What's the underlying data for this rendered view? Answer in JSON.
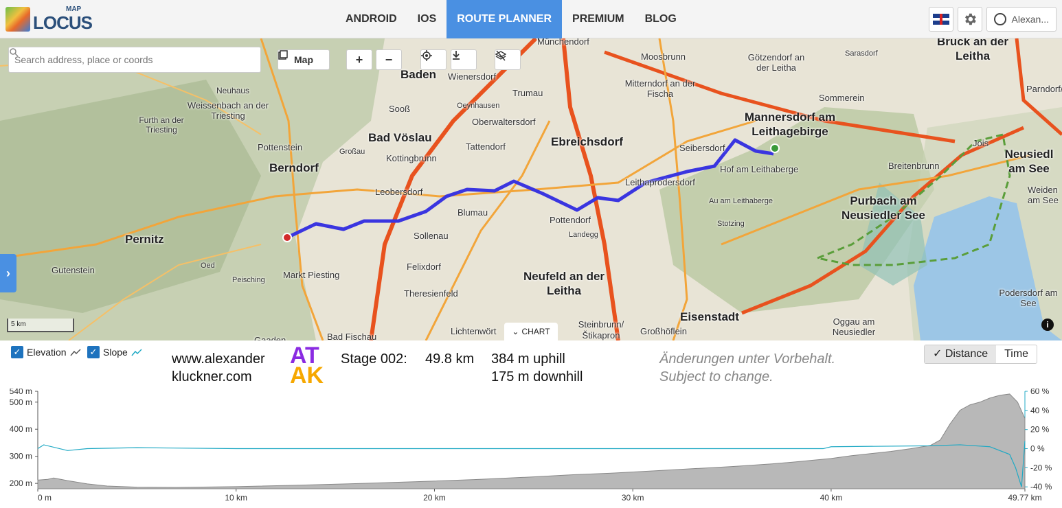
{
  "app": {
    "logo_word": "LOCUS",
    "logo_small": "MAP"
  },
  "nav": [
    {
      "label": "ANDROID",
      "active": false
    },
    {
      "label": "IOS",
      "active": false
    },
    {
      "label": "ROUTE PLANNER",
      "active": true
    },
    {
      "label": "PREMIUM",
      "active": false
    },
    {
      "label": "BLOG",
      "active": false
    }
  ],
  "header_right": {
    "language_icon": "uk-flag-icon",
    "settings_icon": "gear-icon",
    "user_name": "Alexan..."
  },
  "map_controls": {
    "search_placeholder": "Search address, place or coords",
    "search_icon": "search-icon",
    "map_button": "Map",
    "zoom_in": "+",
    "zoom_out": "−",
    "locate_icon": "crosshair-icon",
    "download_icon": "download-icon",
    "layers_off_icon": "layers-off-icon",
    "sidebar_toggle_icon": "chevron-right-icon",
    "scale_label": "5 km",
    "chart_toggle": "CHART",
    "info": "i"
  },
  "map_labels": [
    {
      "text": "Baden",
      "big": true
    },
    {
      "text": "Wienersdorf"
    },
    {
      "text": "Trumau"
    },
    {
      "text": "Münchendorf"
    },
    {
      "text": "Moosbrunn"
    },
    {
      "text": "Götzendorf an der Leitha"
    },
    {
      "text": "Sarasdorf"
    },
    {
      "text": "Bruck an der Leitha",
      "big": true
    },
    {
      "text": "Parndorf/Pa"
    },
    {
      "text": "Neuhaus"
    },
    {
      "text": "Weissenbach an der Triesting"
    },
    {
      "text": "Furth an der Triesting"
    },
    {
      "text": "Sooß"
    },
    {
      "text": "Oeynhausen"
    },
    {
      "text": "Oberwaltersdorf"
    },
    {
      "text": "Mitterndorf an der Fischa"
    },
    {
      "text": "Sommerein"
    },
    {
      "text": "Mannersdorf am Leithagebirge",
      "big": true
    },
    {
      "text": "Bad Vöslau",
      "big": true
    },
    {
      "text": "Tattendorf"
    },
    {
      "text": "Ebreichsdorf",
      "big": true
    },
    {
      "text": "Seibersdorf"
    },
    {
      "text": "Jois"
    },
    {
      "text": "Neusiedl am See",
      "big": true
    },
    {
      "text": "Pottenstein"
    },
    {
      "text": "Großau"
    },
    {
      "text": "Kottingbrunn"
    },
    {
      "text": "Hof am Leithaberge"
    },
    {
      "text": "Breitenbrunn"
    },
    {
      "text": "Weiden am See"
    },
    {
      "text": "Berndorf",
      "big": true
    },
    {
      "text": "Leobersdorf"
    },
    {
      "text": "Leithaprodersdorf"
    },
    {
      "text": "Au am Leithaberge"
    },
    {
      "text": "Purbach am Neusiedler See",
      "big": true
    },
    {
      "text": "Blumau"
    },
    {
      "text": "Pottendorf"
    },
    {
      "text": "Stotzing"
    },
    {
      "text": "Pernitz",
      "big": true
    },
    {
      "text": "Sollenau"
    },
    {
      "text": "Landegg"
    },
    {
      "text": "Oed"
    },
    {
      "text": "Gutenstein"
    },
    {
      "text": "Felixdorf"
    },
    {
      "text": "Markt Piesting"
    },
    {
      "text": "Peisching"
    },
    {
      "text": "Neufeld an der Leitha",
      "big": true
    },
    {
      "text": "Theresienfeld"
    },
    {
      "text": "Podersdorf am See"
    },
    {
      "text": "Steinbrunn/ Štikapron"
    },
    {
      "text": "Eisenstadt",
      "big": true
    },
    {
      "text": "Oggau am Neusiedler"
    },
    {
      "text": "Lichtenwört"
    },
    {
      "text": "Großhöflein"
    },
    {
      "text": "Bad Fischau"
    },
    {
      "text": "Gaaden"
    }
  ],
  "panel": {
    "elevation_label": "Elevation",
    "slope_label": "Slope",
    "site_line1": "www.alexander",
    "site_line2": "kluckner.com",
    "atak_line1": "AT",
    "atak_line2": "AK",
    "stage": "Stage 002:",
    "distance": "49.8 km",
    "uphill": "384 m uphill",
    "downhill": "175 m downhill",
    "note_line1": "Änderungen unter Vorbehalt.",
    "note_line2": "Subject to change.",
    "toggle_distance": "Distance",
    "toggle_time": "Time"
  },
  "colors": {
    "accent": "#4a90e2",
    "route": "#3a35e0",
    "elevation_fill": "#b8b8b8",
    "slope_line": "#1fa9c4",
    "start_marker": "#d22b2b",
    "end_marker": "#3a9a3a"
  },
  "chart_data": {
    "type": "area",
    "x_unit": "km",
    "x_ticks": [
      "0 m",
      "10 km",
      "20 km",
      "30 km",
      "40 km",
      "49.77 km"
    ],
    "x_tick_values": [
      0,
      10,
      20,
      30,
      40,
      49.77
    ],
    "y_left_ticks": [
      "540 m",
      "500 m",
      "400 m",
      "300 m",
      "200 m"
    ],
    "y_left_values": [
      540,
      500,
      400,
      300,
      200
    ],
    "y_right_ticks": [
      "60 %",
      "40 %",
      "20 %",
      "0 %",
      "-20 %",
      "-40 %"
    ],
    "y_right_values": [
      60,
      40,
      20,
      0,
      -20,
      -40
    ],
    "ylim_left": [
      180,
      540
    ],
    "ylim_right": [
      -42,
      60
    ],
    "xlim": [
      0,
      49.77
    ],
    "series": [
      {
        "name": "Elevation",
        "x": [
          0,
          0.5,
          0.8,
          1.5,
          2.5,
          3.5,
          5,
          7,
          10,
          13,
          16,
          19,
          22,
          25,
          27,
          29,
          31,
          33,
          35,
          37,
          38,
          39,
          40,
          41,
          42,
          43,
          44,
          45,
          45.5,
          46,
          46.5,
          47,
          47.5,
          48,
          48.5,
          49,
          49.4,
          49.77
        ],
        "y": [
          212,
          215,
          220,
          210,
          198,
          190,
          186,
          185,
          188,
          193,
          199,
          206,
          214,
          224,
          232,
          238,
          246,
          254,
          262,
          272,
          278,
          285,
          292,
          302,
          310,
          318,
          328,
          340,
          360,
          420,
          470,
          490,
          500,
          515,
          525,
          530,
          500,
          440
        ]
      },
      {
        "name": "Slope",
        "x": [
          0,
          0.3,
          1.5,
          2.5,
          5,
          10,
          20,
          30,
          39.6,
          40,
          45,
          46.5,
          48,
          49,
          49.3,
          49.6,
          49.77
        ],
        "y": [
          0,
          4,
          -2,
          0,
          1,
          0,
          0,
          0,
          0,
          2,
          3,
          4,
          2,
          -6,
          -20,
          -40,
          8
        ]
      }
    ]
  }
}
